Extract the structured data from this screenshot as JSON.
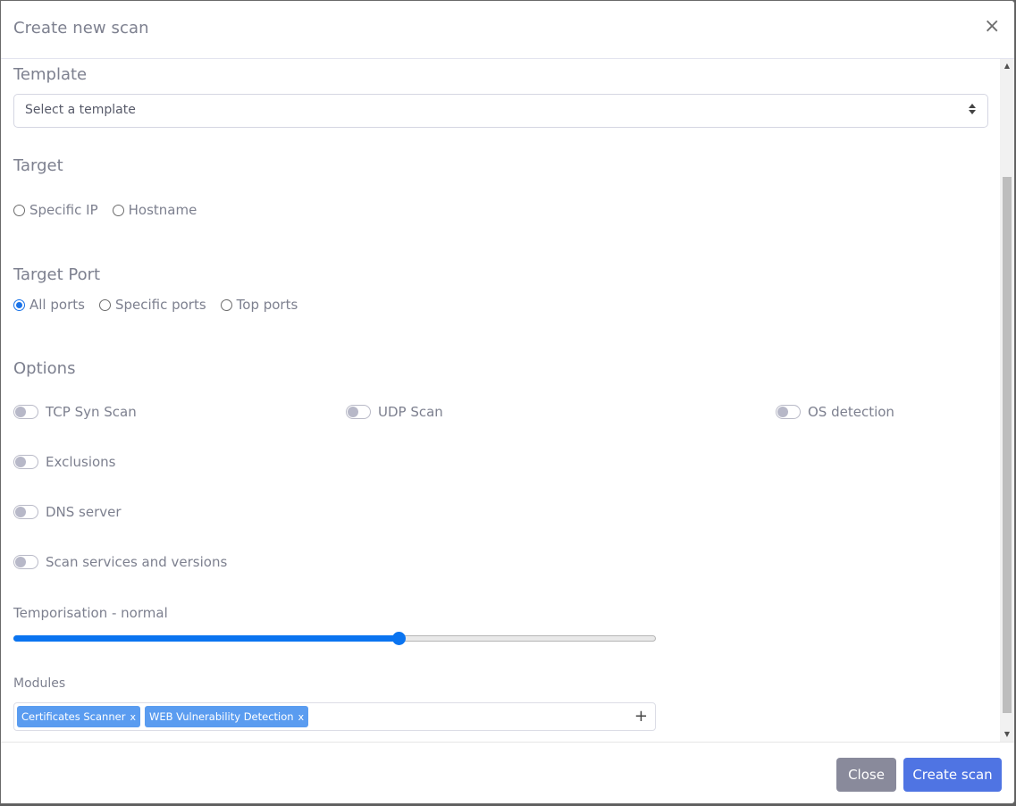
{
  "modal": {
    "title": "Create new scan",
    "close_icon": "×"
  },
  "template": {
    "section_title": "Template",
    "select_value": "Select a template"
  },
  "target": {
    "section_title": "Target",
    "options": [
      {
        "label": "Specific IP",
        "checked": false
      },
      {
        "label": "Hostname",
        "checked": false
      }
    ]
  },
  "target_port": {
    "section_title": "Target Port",
    "options": [
      {
        "label": "All ports",
        "checked": true
      },
      {
        "label": "Specific ports",
        "checked": false
      },
      {
        "label": "Top ports",
        "checked": false
      }
    ]
  },
  "options": {
    "section_title": "Options",
    "toggles": [
      {
        "label": "TCP Syn Scan",
        "enabled": false
      },
      {
        "label": "UDP Scan",
        "enabled": false
      },
      {
        "label": "OS detection",
        "enabled": false
      },
      {
        "label": "Exclusions",
        "enabled": false
      },
      {
        "label": "DNS server",
        "enabled": false
      },
      {
        "label": "Scan services and versions",
        "enabled": false
      }
    ]
  },
  "temporisation": {
    "label": "Temporisation - normal",
    "value_fraction": 0.6
  },
  "modules": {
    "label": "Modules",
    "tags": [
      {
        "label": "Certificates Scanner",
        "remove": "x"
      },
      {
        "label": "WEB Vulnerability Detection",
        "remove": "x"
      }
    ],
    "add_icon": "+"
  },
  "footer": {
    "close_label": "Close",
    "create_label": "Create scan"
  },
  "colors": {
    "accent": "#0a74f0",
    "primary_button": "#4f74e3",
    "secondary_button": "#898a9b",
    "tag": "#5a9cf0"
  }
}
